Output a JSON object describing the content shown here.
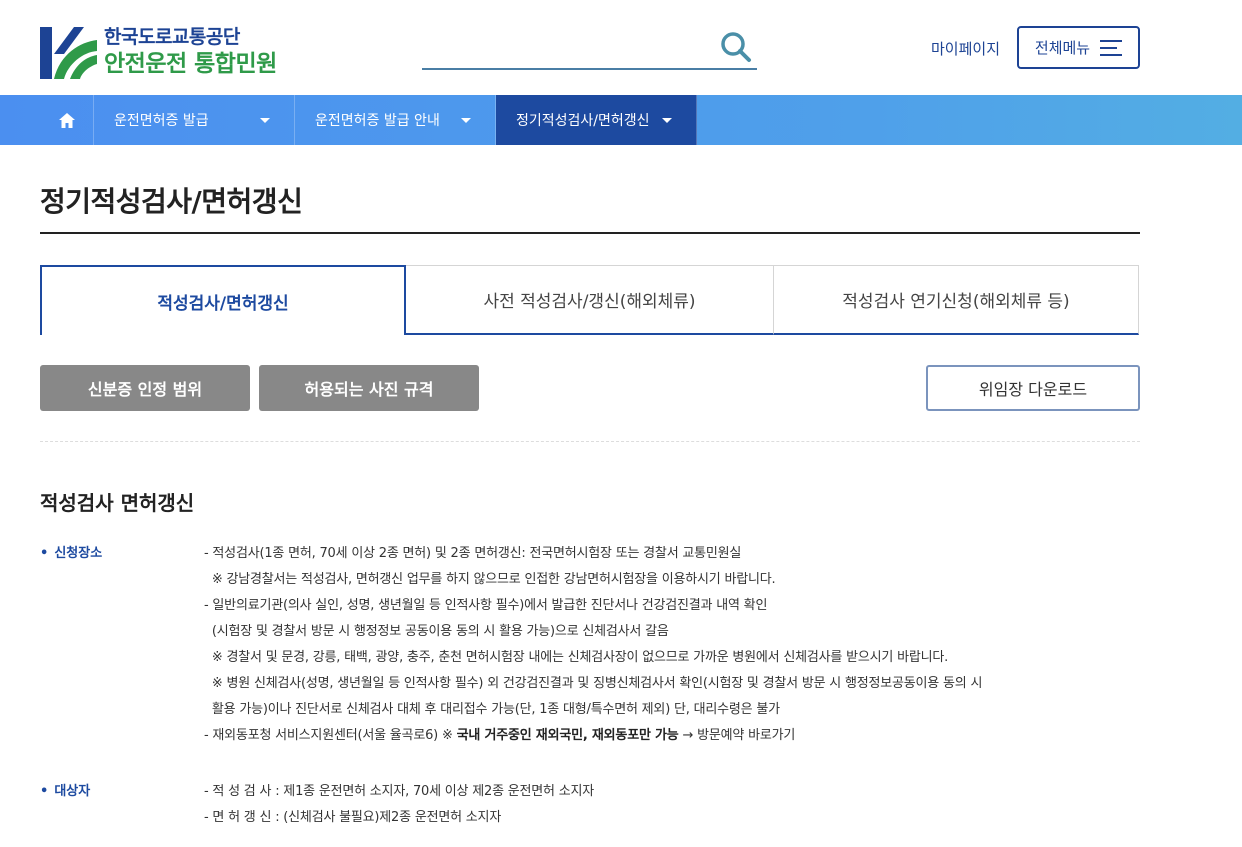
{
  "header": {
    "logo_top": "한국도로교통공단",
    "logo_bottom": "안전운전 통합민원",
    "search_placeholder": "",
    "mypage": "마이페이지",
    "allmenu": "전체메뉴"
  },
  "nav": {
    "items": [
      {
        "label": "운전면허증 발급"
      },
      {
        "label": "운전면허증 발급 안내"
      },
      {
        "label": "정기적성검사/면허갱신"
      }
    ]
  },
  "page": {
    "title": "정기적성검사/면허갱신"
  },
  "tabs": [
    {
      "label": "적성검사/면허갱신"
    },
    {
      "label": "사전 적성검사/갱신(해외체류)"
    },
    {
      "label": "적성검사 연기신청(해외체류 등)"
    }
  ],
  "buttons": {
    "id_range": "신분증 인정 범위",
    "photo_spec": "허용되는 사진 규격",
    "download": "위임장 다운로드"
  },
  "section": {
    "title": "적성검사 면허갱신",
    "place_label": "신청장소",
    "place_lines": [
      "- 적성검사(1종 면허, 70세 이상 2종 면허) 및 2종 면허갱신: 전국면허시험장 또는 경찰서 교통민원실",
      "  ※ 강남경찰서는 적성검사, 면허갱신 업무를 하지 않으므로 인접한 강남면허시험장을 이용하시기 바랍니다.",
      "- 일반의료기관(의사 실인, 성명, 생년월일 등 인적사항 필수)에서 발급한 진단서나 건강검진결과 내역 확인",
      "  (시험장 및 경찰서 방문 시 행정정보 공동이용 동의 시 활용 가능)으로 신체검사서 갈음",
      "  ※ 경찰서 및 문경, 강릉, 태백, 광양, 충주, 춘천 면허시험장 내에는 신체검사장이 없으므로 가까운 병원에서 신체검사를 받으시기 바랍니다.",
      "  ※ 병원 신체검사(성명, 생년월일 등 인적사항 필수) 외 건강검진결과 및 징병신체검사서 확인(시험장 및 경찰서 방문 시 행정정보공동이용 동의 시",
      "  활용 가능)이나 진단서로 신체검사 대체 후 대리접수 가능(단, 1종 대형/특수면허 제외) 단, 대리수령은 불가"
    ],
    "place_last_prefix": "- 재외동포청 서비스지원센터(서울 율곡로6) ※ ",
    "place_last_bold": "국내 거주중인 재외국민, 재외동포만 가능",
    "place_last_suffix": " → 방문예약 바로가기",
    "target_label": "대상자",
    "target_lines": [
      "- 적 성 검 사 : 제1종 운전면허 소지자, 70세 이상 제2종 운전면허 소지자",
      "- 면 허 갱 신 : (신체검사 불필요)제2종 운전면허 소지자"
    ]
  }
}
